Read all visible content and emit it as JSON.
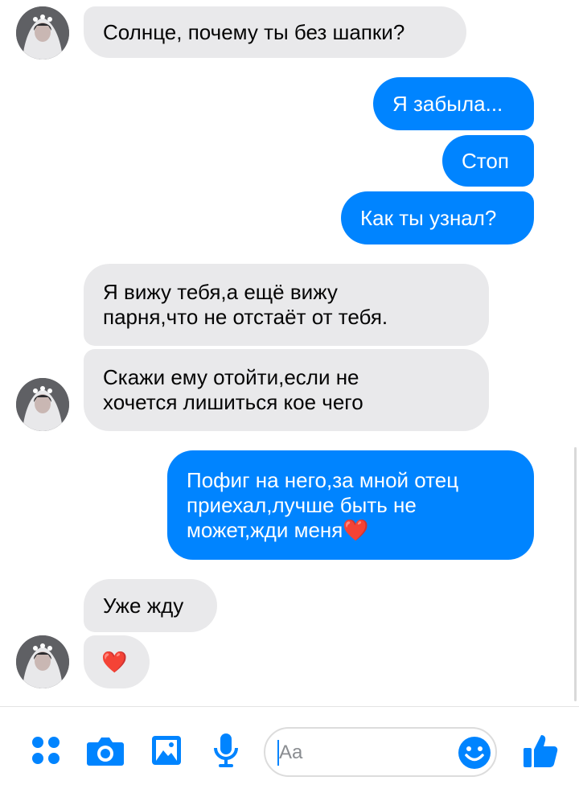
{
  "messages": [
    {
      "id": "m1",
      "dir": "in",
      "text": "Солнце, почему ты без шапки?"
    },
    {
      "id": "m2",
      "dir": "out",
      "text": "Я забыла..."
    },
    {
      "id": "m3",
      "dir": "out",
      "text": "Стоп"
    },
    {
      "id": "m4",
      "dir": "out",
      "text": "Как ты узнал?"
    },
    {
      "id": "m5",
      "dir": "in",
      "text": "Я вижу тебя,а ещё вижу\nпарня,что не отстаёт от тебя."
    },
    {
      "id": "m6",
      "dir": "in",
      "text": "Скажи ему отойти,если не\nхочется лишиться кое чего"
    },
    {
      "id": "m7",
      "dir": "out",
      "text": "Пофиг на него,за мной отец\nприехал,лучше быть не\nможет,жди меня❤️"
    },
    {
      "id": "m8",
      "dir": "in",
      "text": "Уже жду"
    },
    {
      "id": "m9",
      "dir": "in",
      "text": "❤️"
    }
  ],
  "composer": {
    "placeholder": "Aa",
    "tools": [
      "apps-icon",
      "camera-icon",
      "gallery-icon",
      "microphone-icon"
    ],
    "emoji_icon": "smiley-icon",
    "send_icon": "thumbs-up-icon"
  },
  "colors": {
    "outgoing": "#0084ff",
    "incoming": "#e9e9eb",
    "accent": "#0084ff"
  }
}
